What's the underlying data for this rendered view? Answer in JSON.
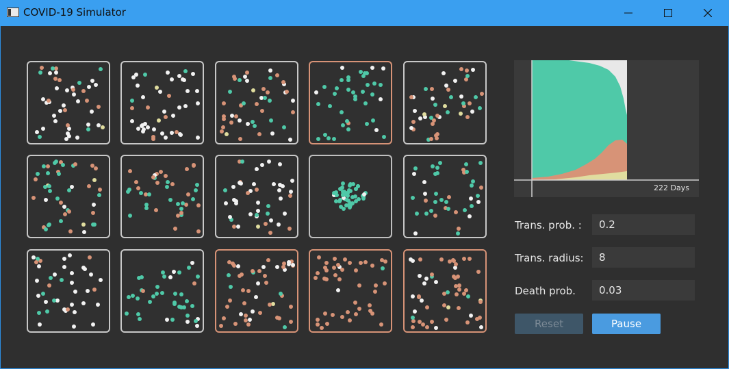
{
  "window": {
    "title": "COVID-19 Simulator"
  },
  "colors": {
    "healthy": "#f2f2f2",
    "infected": "#d79377",
    "recovered": "#4fc9a8",
    "dead": "#e0dd9f",
    "accent": "#4a9be0"
  },
  "chart": {
    "days_label": "222 Days"
  },
  "params": {
    "trans_prob_label": "Trans. prob. :",
    "trans_prob_value": "0.2",
    "trans_radius_label": "Trans. radius:",
    "trans_radius_value": "8",
    "death_prob_label": "Death prob.",
    "death_prob_value": "0.03"
  },
  "buttons": {
    "reset": "Reset",
    "pause": "Pause"
  },
  "cells": [
    {
      "row": 0,
      "col": 0,
      "border": "normal",
      "mix": [
        0.6,
        0.25,
        0.12,
        0.03
      ],
      "count": 45,
      "mode": "uniform"
    },
    {
      "row": 0,
      "col": 1,
      "border": "normal",
      "mix": [
        0.7,
        0.15,
        0.12,
        0.03
      ],
      "count": 45,
      "mode": "uniform"
    },
    {
      "row": 0,
      "col": 2,
      "border": "normal",
      "mix": [
        0.35,
        0.5,
        0.1,
        0.05
      ],
      "count": 45,
      "mode": "uniform"
    },
    {
      "row": 0,
      "col": 3,
      "border": "infected",
      "mix": [
        0.12,
        0.05,
        0.83,
        0.0
      ],
      "count": 40,
      "mode": "uniform"
    },
    {
      "row": 0,
      "col": 4,
      "border": "normal",
      "mix": [
        0.2,
        0.45,
        0.27,
        0.08
      ],
      "count": 45,
      "mode": "uniform"
    },
    {
      "row": 1,
      "col": 0,
      "border": "normal",
      "mix": [
        0.15,
        0.35,
        0.45,
        0.05
      ],
      "count": 45,
      "mode": "uniform"
    },
    {
      "row": 1,
      "col": 1,
      "border": "normal",
      "mix": [
        0.15,
        0.4,
        0.4,
        0.05
      ],
      "count": 40,
      "mode": "uniform"
    },
    {
      "row": 1,
      "col": 2,
      "border": "normal",
      "mix": [
        0.7,
        0.15,
        0.13,
        0.02
      ],
      "count": 45,
      "mode": "uniform"
    },
    {
      "row": 1,
      "col": 3,
      "border": "quarantine",
      "mix": [
        0.05,
        0.0,
        0.95,
        0.0
      ],
      "count": 50,
      "mode": "cluster"
    },
    {
      "row": 1,
      "col": 4,
      "border": "normal",
      "mix": [
        0.15,
        0.2,
        0.65,
        0.0
      ],
      "count": 40,
      "mode": "uniform"
    },
    {
      "row": 2,
      "col": 0,
      "border": "normal",
      "mix": [
        0.7,
        0.15,
        0.1,
        0.05
      ],
      "count": 40,
      "mode": "uniform"
    },
    {
      "row": 2,
      "col": 1,
      "border": "normal",
      "mix": [
        0.25,
        0.05,
        0.7,
        0.0
      ],
      "count": 40,
      "mode": "uniform"
    },
    {
      "row": 2,
      "col": 2,
      "border": "infected",
      "mix": [
        0.2,
        0.7,
        0.08,
        0.02
      ],
      "count": 50,
      "mode": "uniform"
    },
    {
      "row": 2,
      "col": 3,
      "border": "infected",
      "mix": [
        0.1,
        0.85,
        0.05,
        0.0
      ],
      "count": 45,
      "mode": "uniform"
    },
    {
      "row": 2,
      "col": 4,
      "border": "infected",
      "mix": [
        0.25,
        0.65,
        0.05,
        0.05
      ],
      "count": 55,
      "mode": "uniform"
    }
  ]
}
